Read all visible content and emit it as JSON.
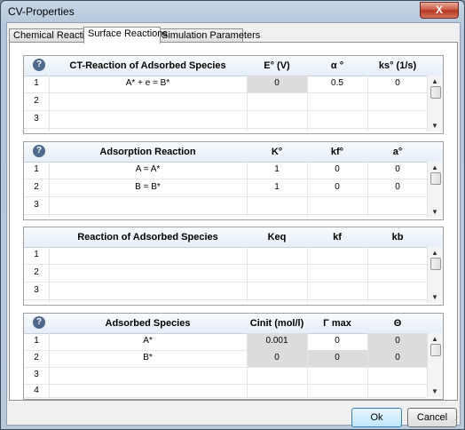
{
  "window": {
    "title": "CV-Properties",
    "close": "X"
  },
  "tabs": [
    {
      "label": "Chemical Reactions"
    },
    {
      "label": "Surface Reactions"
    },
    {
      "label": "Simulation Parameters"
    }
  ],
  "help": "?",
  "ct_reaction": {
    "headers": [
      "CT-Reaction of Adsorbed Species",
      "E° (V)",
      "α °",
      "ks° (1/s)"
    ],
    "rows": [
      [
        "1",
        "A* + e = B*",
        "0",
        "0.5",
        "0"
      ],
      [
        "2",
        "",
        "",
        "",
        ""
      ],
      [
        "3",
        "",
        "",
        "",
        ""
      ]
    ]
  },
  "adsorption": {
    "headers": [
      "Adsorption Reaction",
      "K°",
      "kf°",
      "a°"
    ],
    "rows": [
      [
        "1",
        "A = A*",
        "1",
        "0",
        "0"
      ],
      [
        "2",
        "B = B*",
        "1",
        "0",
        "0"
      ],
      [
        "3",
        "",
        "",
        "",
        ""
      ]
    ]
  },
  "ads_reaction": {
    "headers": [
      "Reaction of Adsorbed Species",
      "Keq",
      "kf",
      "kb"
    ],
    "rows": [
      [
        "1",
        "",
        "",
        "",
        ""
      ],
      [
        "2",
        "",
        "",
        "",
        ""
      ],
      [
        "3",
        "",
        "",
        "",
        ""
      ]
    ]
  },
  "ads_species": {
    "headers": [
      "Adsorbed Species",
      "Cinit (mol/l)",
      "Γ max",
      "Θ"
    ],
    "rows": [
      [
        "1",
        "A*",
        "0.001",
        "0",
        "0"
      ],
      [
        "2",
        "B*",
        "0",
        "0",
        "0"
      ],
      [
        "3",
        "",
        "",
        "",
        ""
      ],
      [
        "4",
        "",
        "",
        "",
        ""
      ]
    ]
  },
  "scroll": {
    "up": "▲",
    "down": "▼"
  },
  "buttons": {
    "ok": "Ok",
    "cancel": "Cancel"
  },
  "resize_grip": "⋰"
}
